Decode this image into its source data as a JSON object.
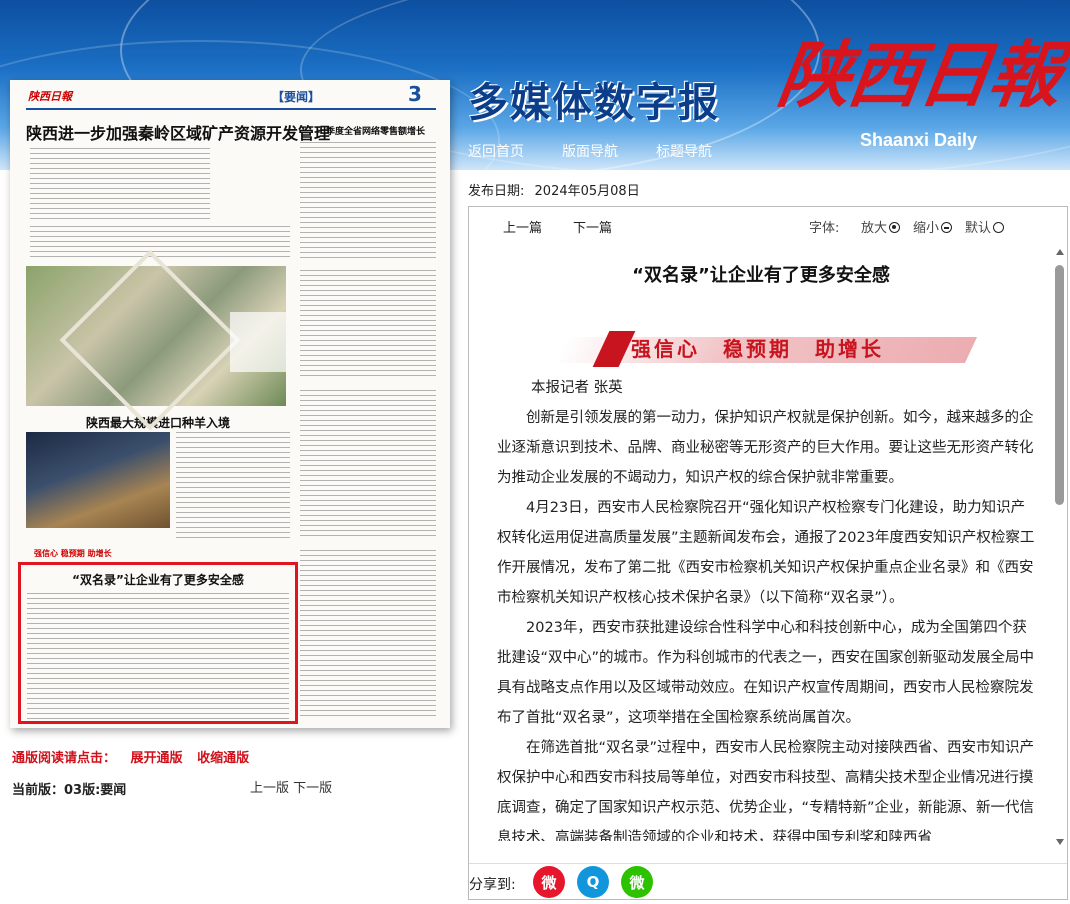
{
  "header": {
    "multimedia_title": "多媒体数字报",
    "logo_cn": "陕西日報",
    "logo_en": "Shaanxi Daily",
    "nav": [
      "返回首页",
      "版面导航",
      "标题导航"
    ]
  },
  "paper_preview": {
    "masthead": "陕西日報",
    "section": "【要闻】",
    "page_num": "3",
    "headline": "陕西进一步加强秦岭区域矿产资源开发管理",
    "sub1": "一季度全省网络零售额增长",
    "sub2": "陕西最大规模进口种羊入境",
    "strip": "强信心 稳预期 助增长",
    "boxed_title": "“双名录”让企业有了更多安全感"
  },
  "left_nav": {
    "notice_label": "通版阅读请点击：",
    "expand": "展开通版",
    "collapse": "收缩通版",
    "current_page": "当前版：03版:要闻",
    "prev_page": "上一版",
    "next_page": "下一版"
  },
  "article": {
    "date_label": "发布日期:",
    "date": "2024年05月08日",
    "prev": "上一篇",
    "next": "下一篇",
    "font_label": "字体:",
    "font_larger": "放大",
    "font_smaller": "缩小",
    "font_default": "默认",
    "title": "“双名录”让企业有了更多安全感",
    "banner": "强信心　稳预期　助增长",
    "author": "本报记者  张英",
    "paragraphs": [
      "创新是引领发展的第一动力，保护知识产权就是保护创新。如今，越来越多的企业逐渐意识到技术、品牌、商业秘密等无形资产的巨大作用。要让这些无形资产转化为推动企业发展的不竭动力，知识产权的综合保护就非常重要。",
      "4月23日，西安市人民检察院召开“强化知识产权检察专门化建设，助力知识产权转化运用促进高质量发展”主题新闻发布会，通报了2023年度西安知识产权检察工作开展情况，发布了第二批《西安市检察机关知识产权保护重点企业名录》和《西安市检察机关知识产权核心技术保护名录》（以下简称“双名录”）。",
      "2023年，西安市获批建设综合性科学中心和科技创新中心，成为全国第四个获批建设“双中心”的城市。作为科创城市的代表之一，西安在国家创新驱动发展全局中具有战略支点作用以及区域带动效应。在知识产权宣传周期间，西安市人民检察院发布了首批“双名录”，这项举措在全国检察系统尚属首次。",
      "在筛选首批“双名录”过程中，西安市人民检察院主动对接陕西省、西安市知识产权保护中心和西安市科技局等单位，对西安市科技型、高精尖技术型企业情况进行摸底调查，确定了国家知识产权示范、优势企业，“专精特新”企业，新能源、新一代信息技术、高端装备制造领域的企业和技术，获得中国专利奖和陕西省"
    ],
    "share_label": "分享到:",
    "share": [
      {
        "name": "weibo",
        "glyph": "微",
        "color": "#e6162d"
      },
      {
        "name": "qq",
        "glyph": "Q",
        "color": "#1296db"
      },
      {
        "name": "wechat",
        "glyph": "微",
        "color": "#2dc100"
      }
    ]
  }
}
